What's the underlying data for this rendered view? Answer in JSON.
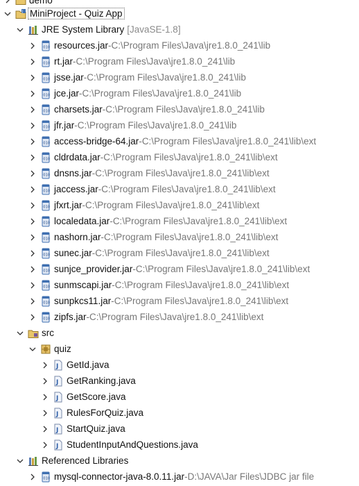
{
  "tree": {
    "cut_item": {
      "label": "demo"
    },
    "project": {
      "label": "MiniProject - Quiz App"
    },
    "jre": {
      "label": "JRE System Library",
      "decoration": "[JavaSE-1.8]"
    },
    "jars": [
      {
        "name": "resources.jar",
        "path": "C:\\Program Files\\Java\\jre1.8.0_241\\lib"
      },
      {
        "name": "rt.jar",
        "path": "C:\\Program Files\\Java\\jre1.8.0_241\\lib"
      },
      {
        "name": "jsse.jar",
        "path": "C:\\Program Files\\Java\\jre1.8.0_241\\lib"
      },
      {
        "name": "jce.jar",
        "path": "C:\\Program Files\\Java\\jre1.8.0_241\\lib"
      },
      {
        "name": "charsets.jar",
        "path": "C:\\Program Files\\Java\\jre1.8.0_241\\lib"
      },
      {
        "name": "jfr.jar",
        "path": "C:\\Program Files\\Java\\jre1.8.0_241\\lib"
      },
      {
        "name": "access-bridge-64.jar",
        "path": "C:\\Program Files\\Java\\jre1.8.0_241\\lib\\ext"
      },
      {
        "name": "cldrdata.jar",
        "path": "C:\\Program Files\\Java\\jre1.8.0_241\\lib\\ext"
      },
      {
        "name": "dnsns.jar",
        "path": "C:\\Program Files\\Java\\jre1.8.0_241\\lib\\ext"
      },
      {
        "name": "jaccess.jar",
        "path": "C:\\Program Files\\Java\\jre1.8.0_241\\lib\\ext"
      },
      {
        "name": "jfxrt.jar",
        "path": "C:\\Program Files\\Java\\jre1.8.0_241\\lib\\ext"
      },
      {
        "name": "localedata.jar",
        "path": "C:\\Program Files\\Java\\jre1.8.0_241\\lib\\ext"
      },
      {
        "name": "nashorn.jar",
        "path": "C:\\Program Files\\Java\\jre1.8.0_241\\lib\\ext"
      },
      {
        "name": "sunec.jar",
        "path": "C:\\Program Files\\Java\\jre1.8.0_241\\lib\\ext"
      },
      {
        "name": "sunjce_provider.jar",
        "path": "C:\\Program Files\\Java\\jre1.8.0_241\\lib\\ext"
      },
      {
        "name": "sunmscapi.jar",
        "path": "C:\\Program Files\\Java\\jre1.8.0_241\\lib\\ext"
      },
      {
        "name": "sunpkcs11.jar",
        "path": "C:\\Program Files\\Java\\jre1.8.0_241\\lib\\ext"
      },
      {
        "name": "zipfs.jar",
        "path": "C:\\Program Files\\Java\\jre1.8.0_241\\lib\\ext"
      }
    ],
    "separator": " - ",
    "src": {
      "label": "src"
    },
    "package": {
      "label": "quiz"
    },
    "java_files": [
      {
        "name": "GetId.java"
      },
      {
        "name": "GetRanking.java"
      },
      {
        "name": "GetScore.java"
      },
      {
        "name": "RulesForQuiz.java"
      },
      {
        "name": "StartQuiz.java"
      },
      {
        "name": "StudentInputAndQuestions.java"
      }
    ],
    "ref_libs": {
      "label": "Referenced Libraries"
    },
    "ref_jars": [
      {
        "name": "mysql-connector-java-8.0.11.jar",
        "path": "D:\\JAVA\\Jar Files\\JDBC jar file"
      }
    ]
  },
  "icons": {
    "chevron_collapsed": "chevron-right-icon",
    "chevron_expanded": "chevron-down-icon",
    "project": "java-project-icon",
    "library": "library-icon",
    "jar": "jar-icon",
    "source_folder": "source-folder-icon",
    "package": "package-icon",
    "java_file": "java-file-icon"
  },
  "colors": {
    "decoration_gray": "#777777",
    "jar_blue": "#3f6fb0",
    "package_brown": "#b58a2e",
    "java_blue": "#2f5fa8"
  }
}
